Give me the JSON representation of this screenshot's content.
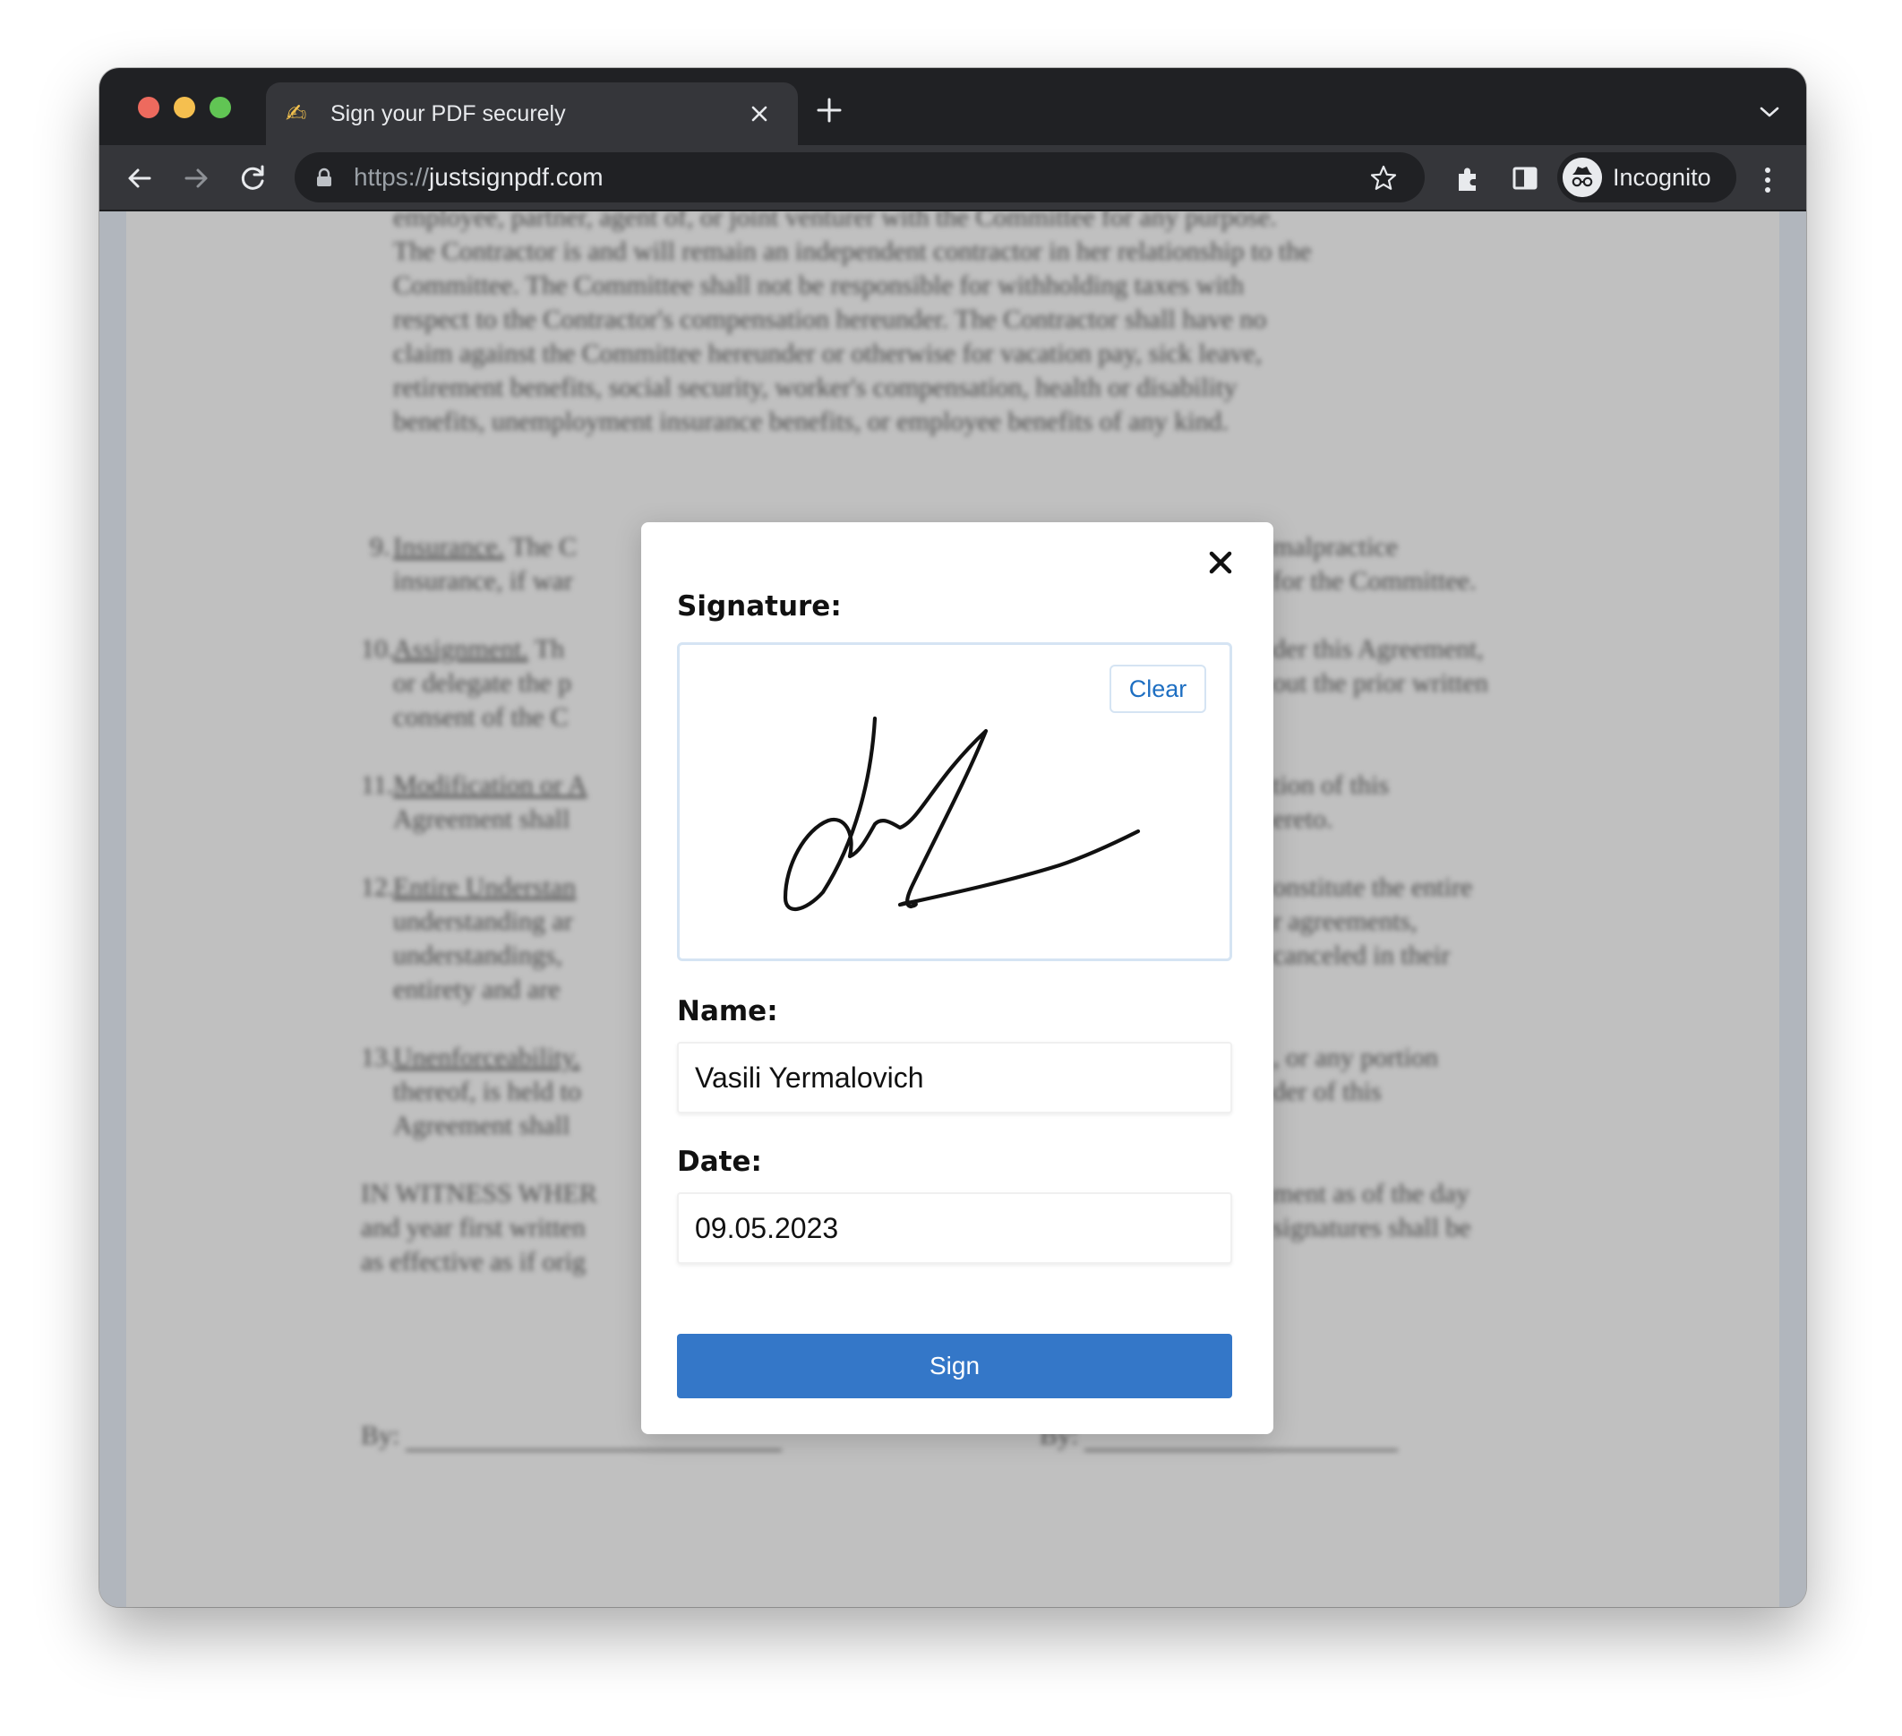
{
  "browser": {
    "tab": {
      "favicon": "✍",
      "title": "Sign your PDF securely"
    },
    "address_bar": {
      "scheme": "https://",
      "host": "justsignpdf.com"
    },
    "profile": {
      "label": "Incognito"
    }
  },
  "document": {
    "intro_paragraph": "employee, partner, agent of, or joint venturer with the Committee for any purpose.\nThe Contractor is and will remain an independent contractor in her relationship to the\nCommittee.  The Committee shall not be responsible for withholding taxes with\nrespect to the Contractor's compensation hereunder.  The Contractor shall have no\nclaim against the Committee hereunder or otherwise for vacation pay, sick leave,\nretirement benefits, social security, worker's compensation, health or disability\nbenefits, unemployment insurance benefits, or employee benefits of any kind.",
    "sections": [
      {
        "number": "9.",
        "heading": "Insurance.",
        "left": "The C\ninsurance, if war",
        "right": "malpractice\nfor the Committee."
      },
      {
        "number": "10.",
        "heading": "Assignment.",
        "left": "Th\nor delegate the p\nconsent of the C",
        "right": "der this Agreement,\nout the prior written"
      },
      {
        "number": "11.",
        "heading": "Modification or A",
        "left": "\nAgreement shall",
        "right": "tion of this\nereto."
      },
      {
        "number": "12.",
        "heading": "Entire Understan",
        "left": "\nunderstanding ar\nunderstandings, \nentirety and are",
        "right": "onstitute the entire\nr agreements,\ncanceled in their"
      },
      {
        "number": "13.",
        "heading": "Unenforceability.",
        "left": "\nthereof, is held to\nAgreement shall",
        "right": ", or any portion\nder of this"
      }
    ],
    "witness_left": "IN WITNESS WHER\nand year first written\nas effective as if orig",
    "witness_right": "ment as of the day\nsignatures shall be",
    "by_left": "By:",
    "by_right": "By:"
  },
  "modal": {
    "signature_label": "Signature:",
    "clear_label": "Clear",
    "name_label": "Name:",
    "name_value": "Vasili Yermalovich",
    "date_label": "Date:",
    "date_value": "09.05.2023",
    "sign_label": "Sign"
  },
  "colors": {
    "accent": "#3477c8",
    "link": "#1e6fc2",
    "tabstrip": "#202124",
    "toolbar": "#35363a"
  }
}
